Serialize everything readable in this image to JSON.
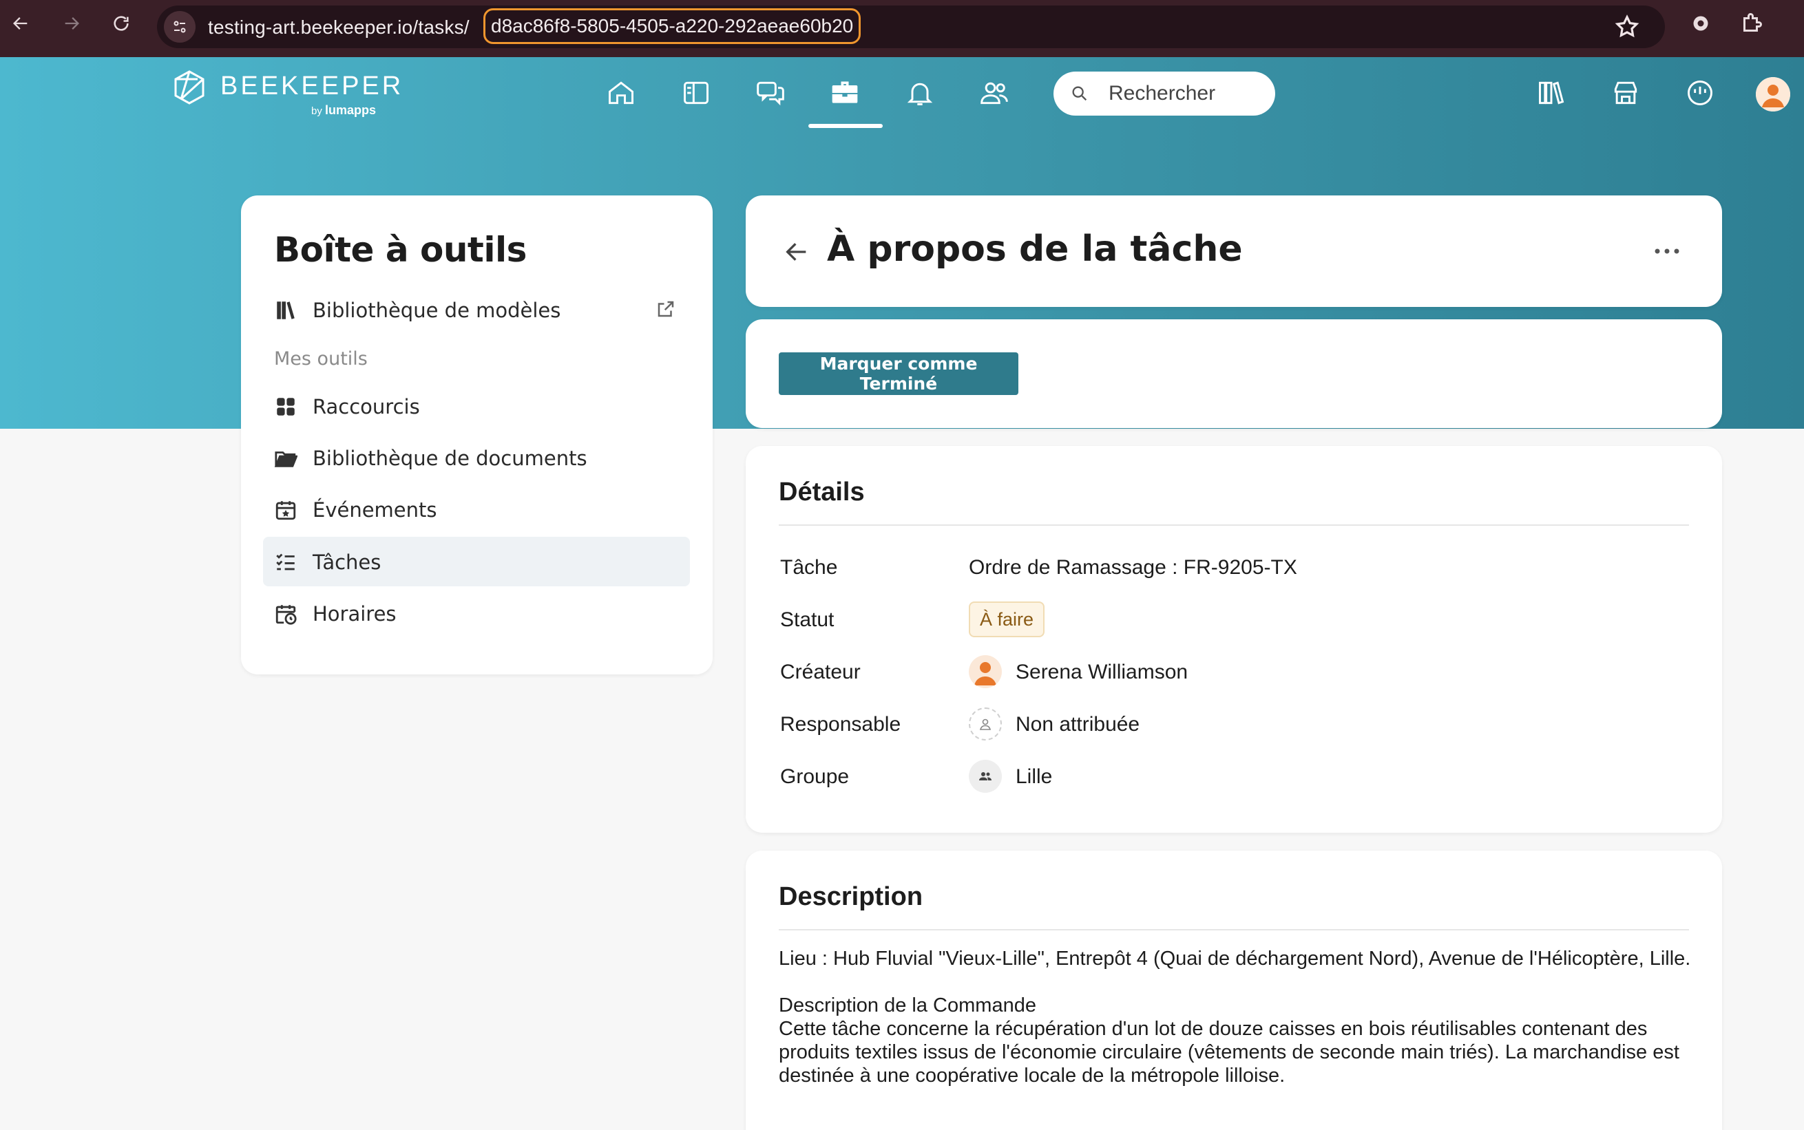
{
  "browser": {
    "url_base": "testing-art.beekeeper.io/tasks/",
    "url_task_id": "d8ac86f8-5805-4505-a220-292aeae60b20"
  },
  "brand": {
    "name": "BEEKEEPER",
    "by": "by",
    "by_name": "lumapps"
  },
  "topnav": {
    "items": [
      "home-icon",
      "news-icon",
      "chats-icon",
      "toolbox-icon",
      "notifications-icon",
      "people-icon"
    ],
    "active": "toolbox-icon",
    "search_placeholder": "Rechercher",
    "right_icons": [
      "library-icon",
      "store-icon",
      "dashboard-icon",
      "avatar"
    ]
  },
  "sidebar": {
    "title": "Boîte à outils",
    "template_library": "Bibliothèque de modèles",
    "section_label": "Mes outils",
    "items": [
      {
        "label": "Raccourcis",
        "icon": "grid-icon"
      },
      {
        "label": "Bibliothèque de documents",
        "icon": "folder-icon"
      },
      {
        "label": "Événements",
        "icon": "calendar-icon"
      },
      {
        "label": "Tâches",
        "icon": "tasks-icon",
        "active": true
      },
      {
        "label": "Horaires",
        "icon": "schedule-icon"
      }
    ]
  },
  "task": {
    "header_title": "À propos de la tâche",
    "mark_done_label": "Marquer comme Terminé",
    "details_title": "Détails",
    "fields": {
      "task_label": "Tâche",
      "task_value": "Ordre de Ramassage : FR-9205-TX",
      "status_label": "Statut",
      "status_value": "À faire",
      "creator_label": "Créateur",
      "creator_value": "Serena Williamson",
      "assignee_label": "Responsable",
      "assignee_value": "Non attribuée",
      "group_label": "Groupe",
      "group_value": "Lille"
    },
    "description_title": "Description",
    "description_text": "Lieu : Hub Fluvial \"Vieux-Lille\", Entrepôt 4 (Quai de déchargement Nord), Avenue de l'Hélicoptère, Lille.\n\nDescription de la Commande\nCette tâche concerne la récupération d'un lot de douze caisses en bois réutilisables contenant des produits textiles issus de l'économie circulaire (vêtements de seconde main triés). La marchandise est destinée à une coopérative locale de la métropole lilloise."
  },
  "colors": {
    "primary_button": "#2f7b8c",
    "header_gradient_start": "#4db8cf",
    "header_gradient_end": "#2e7f93",
    "status_badge_bg": "#fdf4e4",
    "url_highlight": "#f0962e"
  }
}
